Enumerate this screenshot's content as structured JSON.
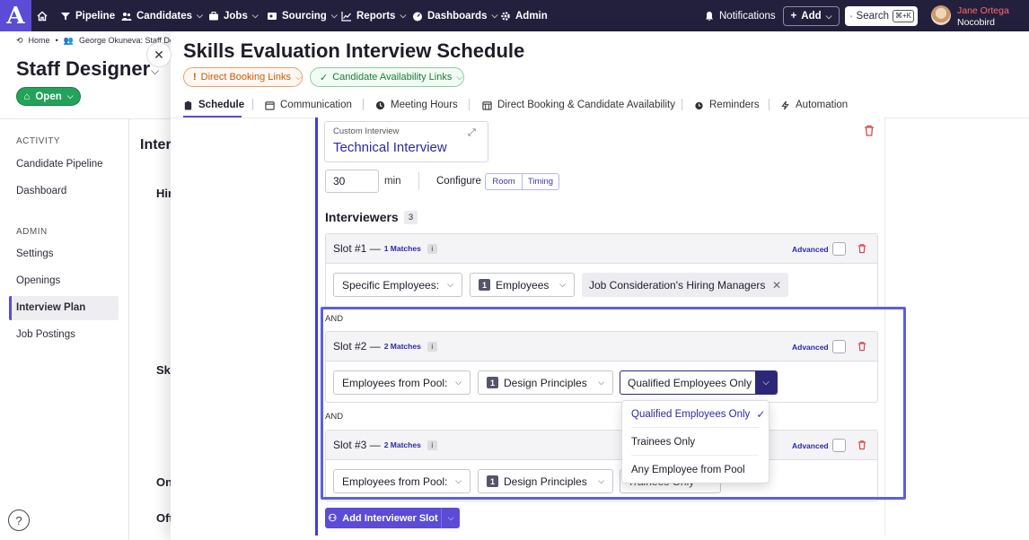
{
  "topnav": {
    "logo": "A",
    "items": [
      {
        "label": "Pipeline"
      },
      {
        "label": "Candidates"
      },
      {
        "label": "Jobs"
      },
      {
        "label": "Sourcing"
      },
      {
        "label": "Reports"
      },
      {
        "label": "Dashboards"
      },
      {
        "label": "Admin"
      }
    ],
    "notifications": "Notifications",
    "add": "Add",
    "search": "Search",
    "search_shortcut": "⌘+K",
    "user_name": "Jane Ortega",
    "user_org": "Nocobird"
  },
  "background_page": {
    "breadcrumb_home": "Home",
    "breadcrumb_candidate": "George Okuneva: Staff Desig",
    "job_title": "Staff Designer",
    "status": "Open",
    "activity_label": "ACTIVITY",
    "activity_items": [
      "Candidate Pipeline",
      "Dashboard"
    ],
    "admin_label": "ADMIN",
    "admin_items": [
      "Settings",
      "Openings",
      "Interview Plan",
      "Job Postings"
    ],
    "peek_texts": [
      "Inter",
      "Hir",
      "Ski",
      "On",
      "Oft"
    ]
  },
  "modal": {
    "title": "Skills Evaluation Interview Schedule",
    "direct_booking_pill": "Direct Booking Links",
    "candidate_availability_pill": "Candidate Availability Links",
    "tabs": [
      {
        "label": "Schedule",
        "active": true
      },
      {
        "label": "Communication"
      },
      {
        "label": "Meeting Hours"
      },
      {
        "label": "Direct Booking & Candidate Availability"
      },
      {
        "label": "Reminders"
      },
      {
        "label": "Automation"
      }
    ]
  },
  "interview": {
    "type_label": "Custom Interview",
    "name": "Technical Interview",
    "duration": "30",
    "duration_unit": "min",
    "configure_label": "Configure",
    "configure_options": [
      "Room",
      "Timing"
    ],
    "interviewers_heading": "Interviewers",
    "interviewers_count": "3",
    "and_label": "AND",
    "advanced_label": "Advanced",
    "add_slot_button": "Add Interviewer Slot"
  },
  "slots": [
    {
      "title": "Slot #1 —",
      "matches": "1 Matches",
      "source": "Specific Employees:",
      "group_count": "1",
      "group": "Employees",
      "tag": "Job Consideration's Hiring Managers"
    },
    {
      "title": "Slot #2 —",
      "matches": "2 Matches",
      "source": "Employees from Pool:",
      "pool_count": "1",
      "pool": "Design Principles",
      "qualification": "Qualified Employees Only"
    },
    {
      "title": "Slot #3 —",
      "matches": "2 Matches",
      "source": "Employees from Pool:",
      "pool_count": "1",
      "pool": "Design Principles",
      "qualification": "Trainees Only"
    }
  ],
  "qualification_dropdown": {
    "options": [
      "Qualified Employees Only",
      "Trainees Only",
      "Any Employee from Pool"
    ],
    "selected": "Qualified Employees Only"
  },
  "icons": {
    "accent": "#5b4bd6",
    "nav_bg": "#23203d",
    "danger": "#d64545"
  }
}
